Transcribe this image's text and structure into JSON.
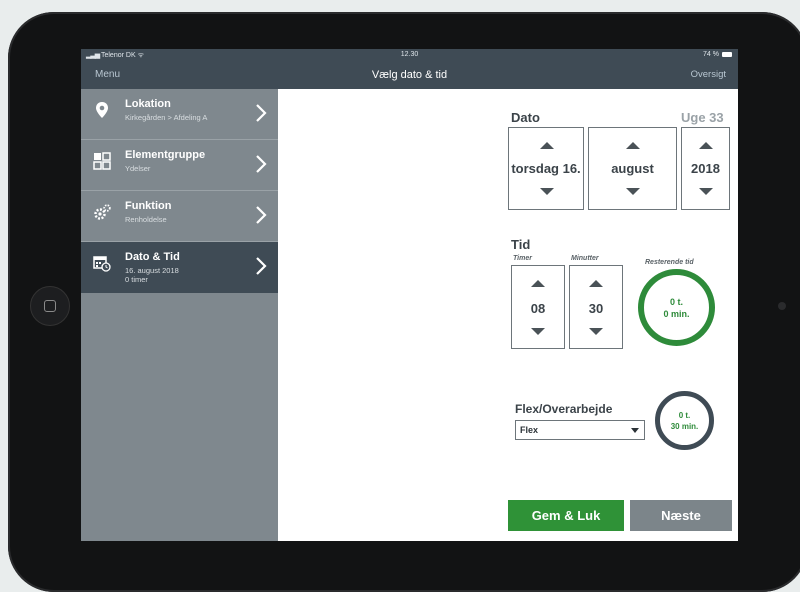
{
  "status_bar": {
    "carrier": "Telenor DK",
    "time": "12.30",
    "battery": "74 %"
  },
  "nav": {
    "menu_label": "Menu",
    "title": "Vælg dato & tid",
    "overview_label": "Oversigt"
  },
  "sidebar": {
    "items": [
      {
        "title": "Lokation",
        "subtitle": "Kirkegården > Afdeling A",
        "icon": "location-pin-icon"
      },
      {
        "title": "Elementgruppe",
        "subtitle": "Ydelser",
        "icon": "element-group-icon"
      },
      {
        "title": "Funktion",
        "subtitle": "Renholdelse",
        "icon": "gears-icon"
      },
      {
        "title": "Dato & Tid",
        "subtitle": "16. august 2018",
        "subtitle2": "0 timer",
        "icon": "calendar-clock-icon",
        "active": true
      }
    ]
  },
  "date": {
    "label": "Dato",
    "week_label": "Uge 33",
    "day": "torsdag 16.",
    "month": "august",
    "year": "2018"
  },
  "time": {
    "label": "Tid",
    "hours_label": "Timer",
    "minutes_label": "Minutter",
    "hours": "08",
    "minutes": "30",
    "remaining_label": "Resterende tid",
    "remaining_hours": "0 t.",
    "remaining_minutes": "0 min."
  },
  "flex": {
    "label": "Flex/Overarbejde",
    "selected": "Flex",
    "ring_hours": "0 t.",
    "ring_minutes": "30 min."
  },
  "buttons": {
    "save_close": "Gem & Luk",
    "next": "Næste"
  },
  "colors": {
    "nav_bg": "#3f4b55",
    "sidebar_bg": "#7f888e",
    "green": "#2e8b3a",
    "green_button": "#2f9237",
    "gray_button": "#7c858a"
  }
}
